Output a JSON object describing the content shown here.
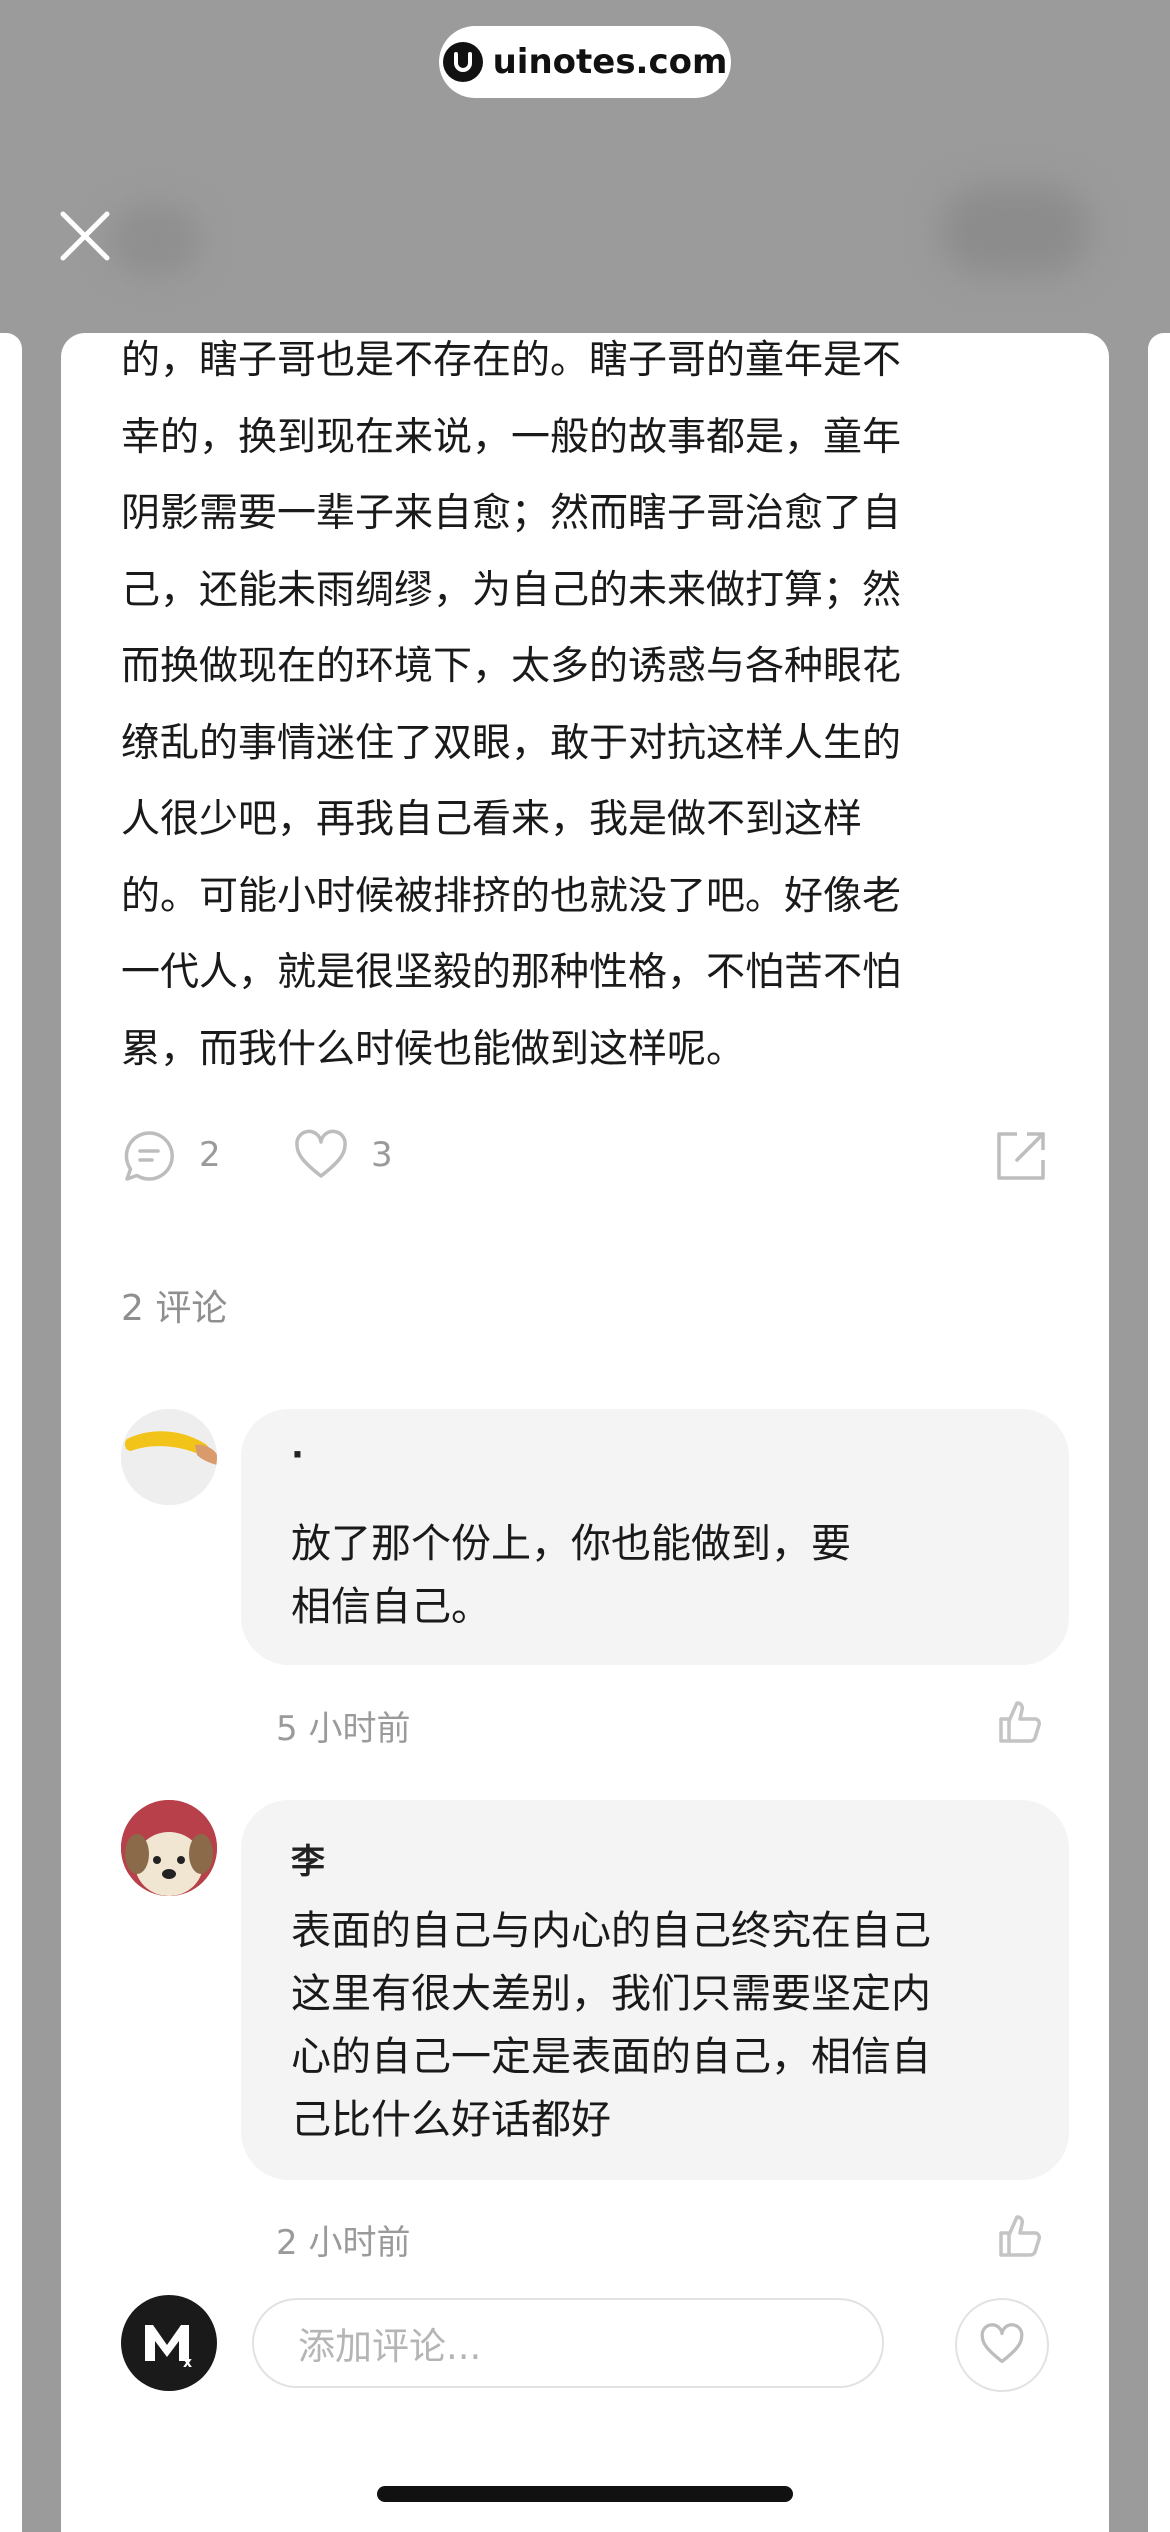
{
  "watermark": {
    "text": "uinotes.com"
  },
  "post": {
    "body": "的，瞎子哥也是不存在的。瞎子哥的童年是不\n幸的，换到现在来说，一般的故事都是，童年\n阴影需要一辈子来自愈；然而瞎子哥治愈了自\n己，还能未雨绸缪，为自己的未来做打算；然\n而换做现在的环境下，太多的诱惑与各种眼花\n缭乱的事情迷住了双眼，敢于对抗这样人生的\n人很少吧，再我自己看来，我是做不到这样\n的。可能小时候被排挤的也就没了吧。好像老\n一代人，就是很坚毅的那种性格，不怕苦不怕\n累，而我什么时候也能做到这样呢。",
    "comment_count": "2",
    "like_count": "3"
  },
  "comments_section": {
    "title": "2 评论",
    "items": [
      {
        "author": "·",
        "text": "放了那个份上，你也能做到，要\n相信自己。",
        "time": "5 小时前"
      },
      {
        "author": "李",
        "text": "表面的自己与内心的自己终究在自己\n这里有很大差别，我们只需要坚定内\n心的自己一定是表面的自己，相信自\n己比什么好话都好",
        "time": "2 小时前"
      }
    ]
  },
  "composer": {
    "placeholder": "添加评论..."
  },
  "icons": {
    "close": "close-icon",
    "comment": "comment-icon",
    "like": "heart-icon",
    "share": "share-icon",
    "thumb": "thumbs-up-icon"
  }
}
